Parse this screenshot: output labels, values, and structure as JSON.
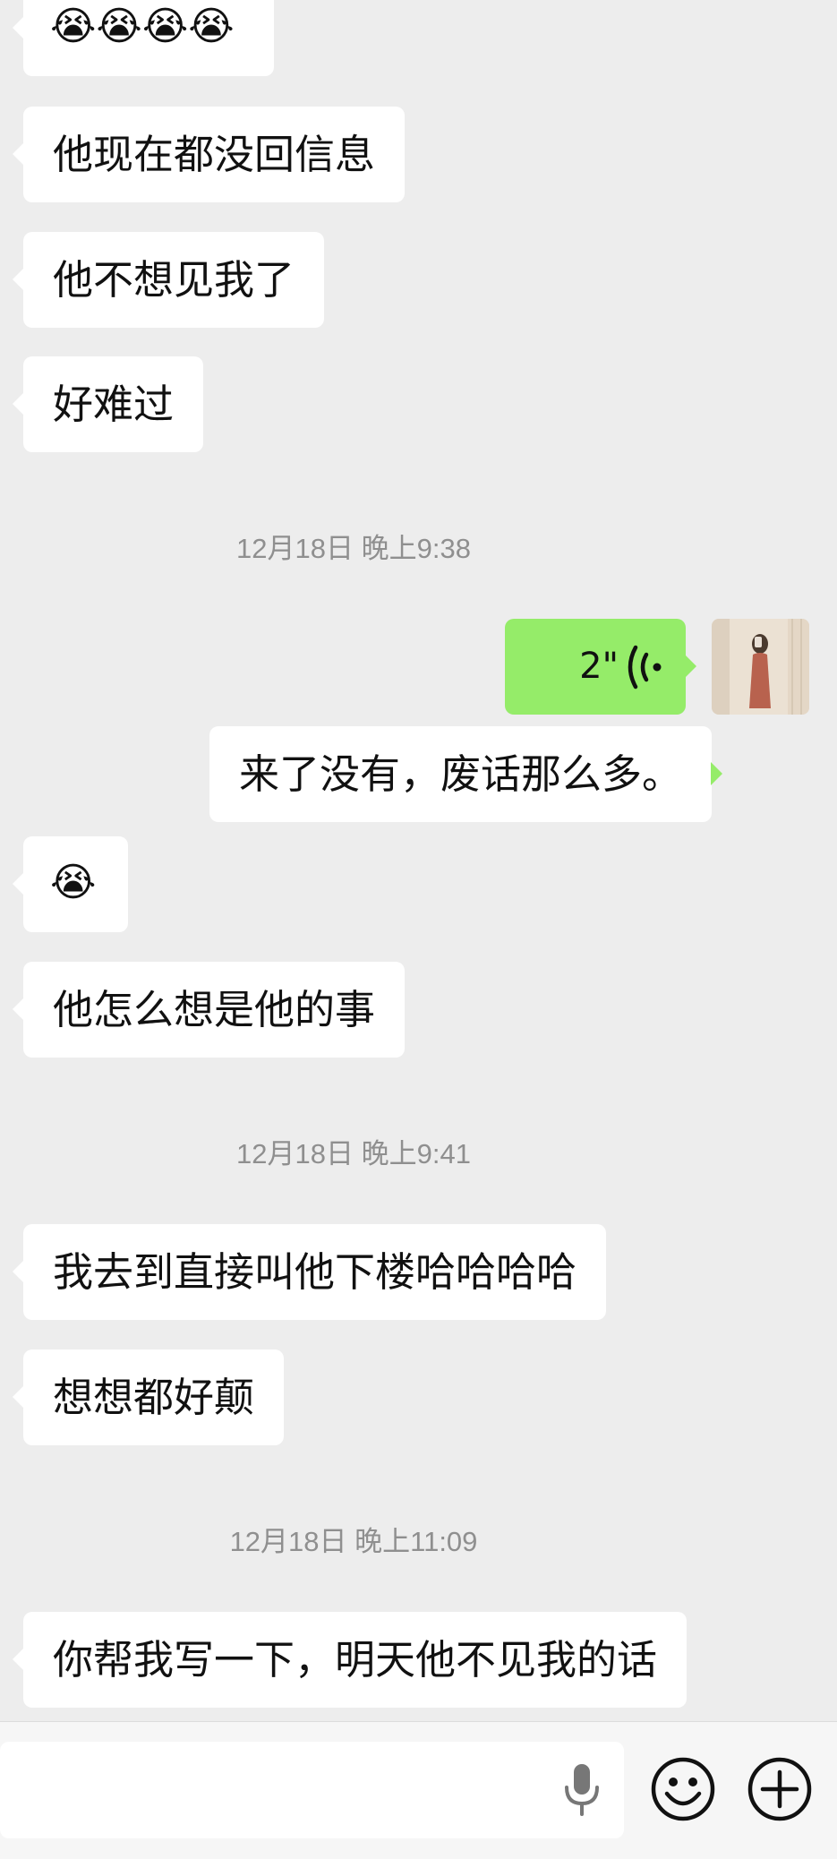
{
  "messages": {
    "m0_emojis": "😭😭😭😭",
    "m1": "他现在都没回信息",
    "m2": "他不想见我了",
    "m3": "好难过",
    "time1": "12月18日 晚上9:38",
    "voice_duration": "2\"",
    "m4": "来了没有，废话那么多。",
    "m5_emoji": "😭",
    "m6": "他怎么想是他的事",
    "time2": "12月18日 晚上9:41",
    "m7": "我去到直接叫他下楼哈哈哈哈",
    "m8": "想想都好颠",
    "time3": "12月18日 晚上11:09",
    "m9": "你帮我写一下，明天他不见我的话"
  },
  "input": {
    "value": ""
  },
  "icons": {
    "mic": "microphone-icon",
    "emoji": "smiley-face-icon",
    "plus": "plus-circle-icon",
    "voice": "voice-wave-icon",
    "crying": "crying-face-emoji"
  },
  "colors": {
    "background": "#ededed",
    "self_bubble": "#95ec69",
    "other_bubble": "#ffffff",
    "timestamp": "#8f8f8f"
  }
}
